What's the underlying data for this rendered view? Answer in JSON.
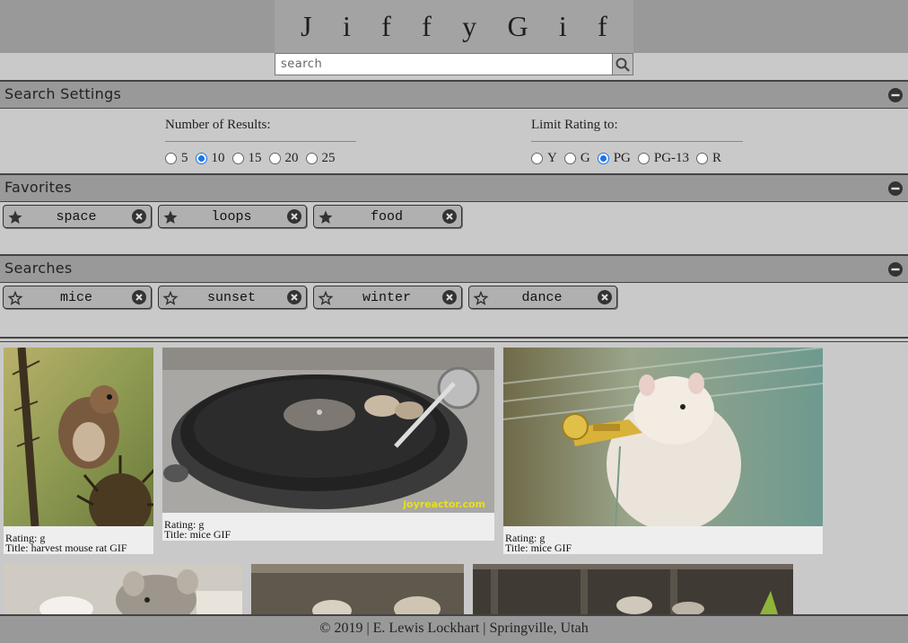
{
  "header": {
    "title_letters": [
      "J",
      "i",
      "f",
      "f",
      "y",
      "G",
      "i",
      "f"
    ]
  },
  "search": {
    "placeholder": "search",
    "value": ""
  },
  "sections": {
    "settings": {
      "title": "Search Settings"
    },
    "favorites": {
      "title": "Favorites"
    },
    "searches": {
      "title": "Searches"
    }
  },
  "settings": {
    "results": {
      "label": "Number of Results:",
      "options": [
        "5",
        "10",
        "15",
        "20",
        "25"
      ],
      "selected": "10"
    },
    "rating": {
      "label": "Limit Rating to:",
      "options": [
        "Y",
        "G",
        "PG",
        "PG-13",
        "R"
      ],
      "selected": "PG"
    }
  },
  "favorites": [
    "space",
    "loops",
    "food"
  ],
  "searches": [
    "mice",
    "sunset",
    "winter",
    "dance"
  ],
  "results": [
    {
      "rating_label": "Rating: g",
      "title_label": "Title: harvest mouse rat GIF"
    },
    {
      "rating_label": "Rating: g",
      "title_label": "Title: mice GIF",
      "watermark": "joyreactor.com"
    },
    {
      "rating_label": "Rating: g",
      "title_label": "Title: mice GIF"
    }
  ],
  "footer": {
    "text": "© 2019 | E. Lewis Lockhart | Springville, Utah"
  },
  "colors": {
    "bar": "#999999",
    "page": "#c9c9c9",
    "accent": "#1a73e8"
  }
}
